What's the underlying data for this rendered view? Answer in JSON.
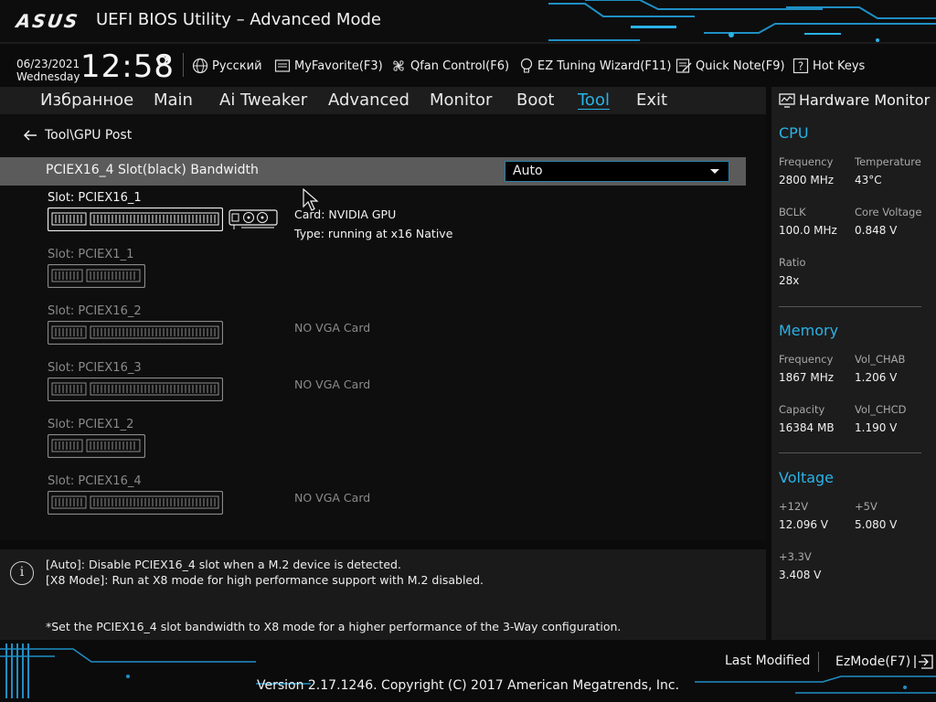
{
  "header": {
    "logo": "ASUS",
    "title": "UEFI BIOS Utility – Advanced Mode"
  },
  "infobar": {
    "date": "06/23/2021",
    "weekday": "Wednesday",
    "time": "12:58",
    "settings_icon": "gear-icon",
    "items": [
      {
        "label": "Русский",
        "icon": "globe-icon"
      },
      {
        "label": "MyFavorite(F3)",
        "icon": "favorite-icon"
      },
      {
        "label": "Qfan Control(F6)",
        "icon": "fan-icon"
      },
      {
        "label": "EZ Tuning Wizard(F11)",
        "icon": "lightbulb-icon"
      },
      {
        "label": "Quick Note(F9)",
        "icon": "note-icon"
      },
      {
        "label": "Hot Keys",
        "icon": "question-icon"
      }
    ]
  },
  "tabs": [
    {
      "label": "Избранное",
      "active": false
    },
    {
      "label": "Main",
      "active": false
    },
    {
      "label": "Ai Tweaker",
      "active": false
    },
    {
      "label": "Advanced",
      "active": false
    },
    {
      "label": "Monitor",
      "active": false
    },
    {
      "label": "Boot",
      "active": false
    },
    {
      "label": "Tool",
      "active": true
    },
    {
      "label": "Exit",
      "active": false
    }
  ],
  "breadcrumb": "Tool\\GPU Post",
  "setting": {
    "label": "PCIEX16_4 Slot(black) Bandwidth",
    "value": "Auto"
  },
  "slots": [
    {
      "label": "Slot: PCIEX16_1",
      "populated": true,
      "card": "Card: NVIDIA GPU",
      "type": "Type: running at x16 Native"
    },
    {
      "label": "Slot: PCIEX1_1",
      "populated": false,
      "card": "",
      "type": ""
    },
    {
      "label": "Slot: PCIEX16_2",
      "populated": false,
      "card": "NO VGA Card",
      "type": ""
    },
    {
      "label": "Slot: PCIEX16_3",
      "populated": false,
      "card": "NO VGA Card",
      "type": ""
    },
    {
      "label": "Slot: PCIEX1_2",
      "populated": false,
      "card": "",
      "type": ""
    },
    {
      "label": "Slot: PCIEX16_4",
      "populated": false,
      "card": "NO VGA Card",
      "type": ""
    }
  ],
  "help": {
    "line1": "[Auto]: Disable PCIEX16_4 slot when a M.2 device is detected.",
    "line2": "[X8 Mode]: Run at X8 mode for high performance support with M.2 disabled.",
    "line3": "*Set the PCIEX16_4 slot bandwidth to X8 mode for a higher performance of the 3-Way configuration."
  },
  "hardware_monitor": {
    "title": "Hardware Monitor",
    "cpu": {
      "title": "CPU",
      "frequency_label": "Frequency",
      "frequency": "2800 MHz",
      "temperature_label": "Temperature",
      "temperature": "43°C",
      "bclk_label": "BCLK",
      "bclk": "100.0 MHz",
      "core_voltage_label": "Core Voltage",
      "core_voltage": "0.848 V",
      "ratio_label": "Ratio",
      "ratio": "28x"
    },
    "memory": {
      "title": "Memory",
      "frequency_label": "Frequency",
      "frequency": "1867 MHz",
      "vol_chab_label": "Vol_CHAB",
      "vol_chab": "1.206 V",
      "capacity_label": "Capacity",
      "capacity": "16384 MB",
      "vol_chcd_label": "Vol_CHCD",
      "vol_chcd": "1.190 V"
    },
    "voltage": {
      "title": "Voltage",
      "v12_label": "+12V",
      "v12": "12.096 V",
      "v5_label": "+5V",
      "v5": "5.080 V",
      "v33_label": "+3.3V",
      "v33": "3.408 V"
    }
  },
  "footer": {
    "last_modified": "Last Modified",
    "ezmode": "EzMode(F7)",
    "copyright": "Version 2.17.1246. Copyright (C) 2017 American Megatrends, Inc."
  },
  "colors": {
    "accent": "#2ab3e6",
    "setting_row": "#5b5b5b",
    "panel": "#1c1c1c"
  }
}
